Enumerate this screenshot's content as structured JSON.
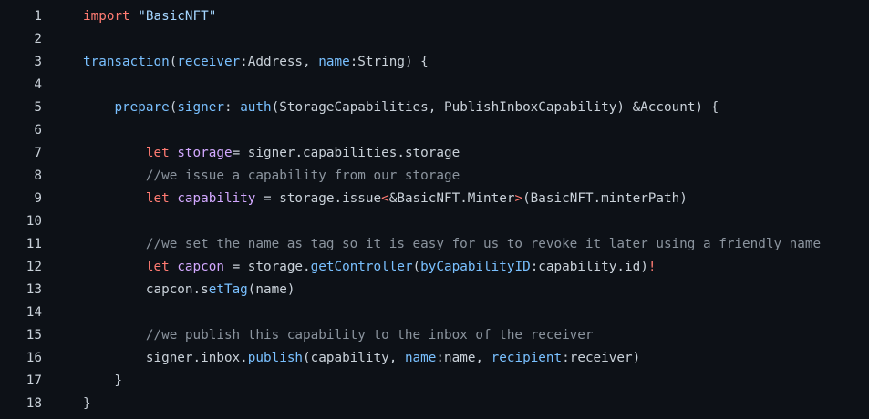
{
  "lines": [
    {
      "n": "1",
      "tokens": [
        {
          "t": "import ",
          "c": "kw"
        },
        {
          "t": "\"BasicNFT\"",
          "c": "str"
        }
      ]
    },
    {
      "n": "2",
      "tokens": []
    },
    {
      "n": "3",
      "tokens": [
        {
          "t": "transaction",
          "c": "prm"
        },
        {
          "t": "(",
          "c": "plain"
        },
        {
          "t": "receiver",
          "c": "prm"
        },
        {
          "t": ":Address, ",
          "c": "plain"
        },
        {
          "t": "name",
          "c": "prm"
        },
        {
          "t": ":String) {",
          "c": "plain"
        }
      ]
    },
    {
      "n": "4",
      "tokens": []
    },
    {
      "n": "5",
      "tokens": [
        {
          "t": "    ",
          "c": "plain"
        },
        {
          "t": "prepare",
          "c": "prm"
        },
        {
          "t": "(",
          "c": "plain"
        },
        {
          "t": "signer",
          "c": "prm"
        },
        {
          "t": ": ",
          "c": "plain"
        },
        {
          "t": "auth",
          "c": "prm"
        },
        {
          "t": "(StorageCapabilities, PublishInboxCapability) &Account) {",
          "c": "plain"
        }
      ]
    },
    {
      "n": "6",
      "tokens": []
    },
    {
      "n": "7",
      "tokens": [
        {
          "t": "        ",
          "c": "plain"
        },
        {
          "t": "let ",
          "c": "kw"
        },
        {
          "t": "storage",
          "c": "fn"
        },
        {
          "t": "= signer.capabilities.storage",
          "c": "plain"
        }
      ]
    },
    {
      "n": "8",
      "tokens": [
        {
          "t": "        ",
          "c": "plain"
        },
        {
          "t": "//we issue a capability from our storage",
          "c": "cmt"
        }
      ]
    },
    {
      "n": "9",
      "tokens": [
        {
          "t": "        ",
          "c": "plain"
        },
        {
          "t": "let ",
          "c": "kw"
        },
        {
          "t": "capability",
          "c": "fn"
        },
        {
          "t": " = storage.issue",
          "c": "plain"
        },
        {
          "t": "<",
          "c": "kw"
        },
        {
          "t": "&BasicNFT.Minter",
          "c": "plain"
        },
        {
          "t": ">",
          "c": "kw"
        },
        {
          "t": "(BasicNFT.minterPath)",
          "c": "plain"
        }
      ]
    },
    {
      "n": "10",
      "tokens": []
    },
    {
      "n": "11",
      "tokens": [
        {
          "t": "        ",
          "c": "plain"
        },
        {
          "t": "//we set the name as tag so it is easy for us to revoke it later using a friendly name",
          "c": "cmt"
        }
      ]
    },
    {
      "n": "12",
      "tokens": [
        {
          "t": "        ",
          "c": "plain"
        },
        {
          "t": "let ",
          "c": "kw"
        },
        {
          "t": "capcon",
          "c": "fn"
        },
        {
          "t": " = storage.",
          "c": "plain"
        },
        {
          "t": "getController",
          "c": "prm"
        },
        {
          "t": "(",
          "c": "plain"
        },
        {
          "t": "byCapabilityID",
          "c": "prm"
        },
        {
          "t": ":capability.id)",
          "c": "plain"
        },
        {
          "t": "!",
          "c": "kw"
        }
      ]
    },
    {
      "n": "13",
      "tokens": [
        {
          "t": "        ",
          "c": "plain"
        },
        {
          "t": "capcon.s",
          "c": "plain"
        },
        {
          "t": "etTag",
          "c": "prm"
        },
        {
          "t": "(name)",
          "c": "plain"
        }
      ]
    },
    {
      "n": "14",
      "tokens": []
    },
    {
      "n": "15",
      "tokens": [
        {
          "t": "        ",
          "c": "plain"
        },
        {
          "t": "//we publish this capability to the inbox of the receiver",
          "c": "cmt"
        }
      ]
    },
    {
      "n": "16",
      "tokens": [
        {
          "t": "        ",
          "c": "plain"
        },
        {
          "t": "signer.inbox.",
          "c": "plain"
        },
        {
          "t": "publish",
          "c": "prm"
        },
        {
          "t": "(capability, ",
          "c": "plain"
        },
        {
          "t": "name",
          "c": "prm"
        },
        {
          "t": ":name, ",
          "c": "plain"
        },
        {
          "t": "recipient",
          "c": "prm"
        },
        {
          "t": ":receiver)",
          "c": "plain"
        }
      ]
    },
    {
      "n": "17",
      "tokens": [
        {
          "t": "    }",
          "c": "plain"
        }
      ]
    },
    {
      "n": "18",
      "tokens": [
        {
          "t": "}",
          "c": "plain"
        }
      ]
    }
  ],
  "colors": {
    "background": "#0d1117",
    "keyword": "#ff7b72",
    "string": "#a5d6ff",
    "variable": "#d2a8ff",
    "function": "#79c0ff",
    "text": "#c9d1d9",
    "comment": "#8b949e"
  }
}
